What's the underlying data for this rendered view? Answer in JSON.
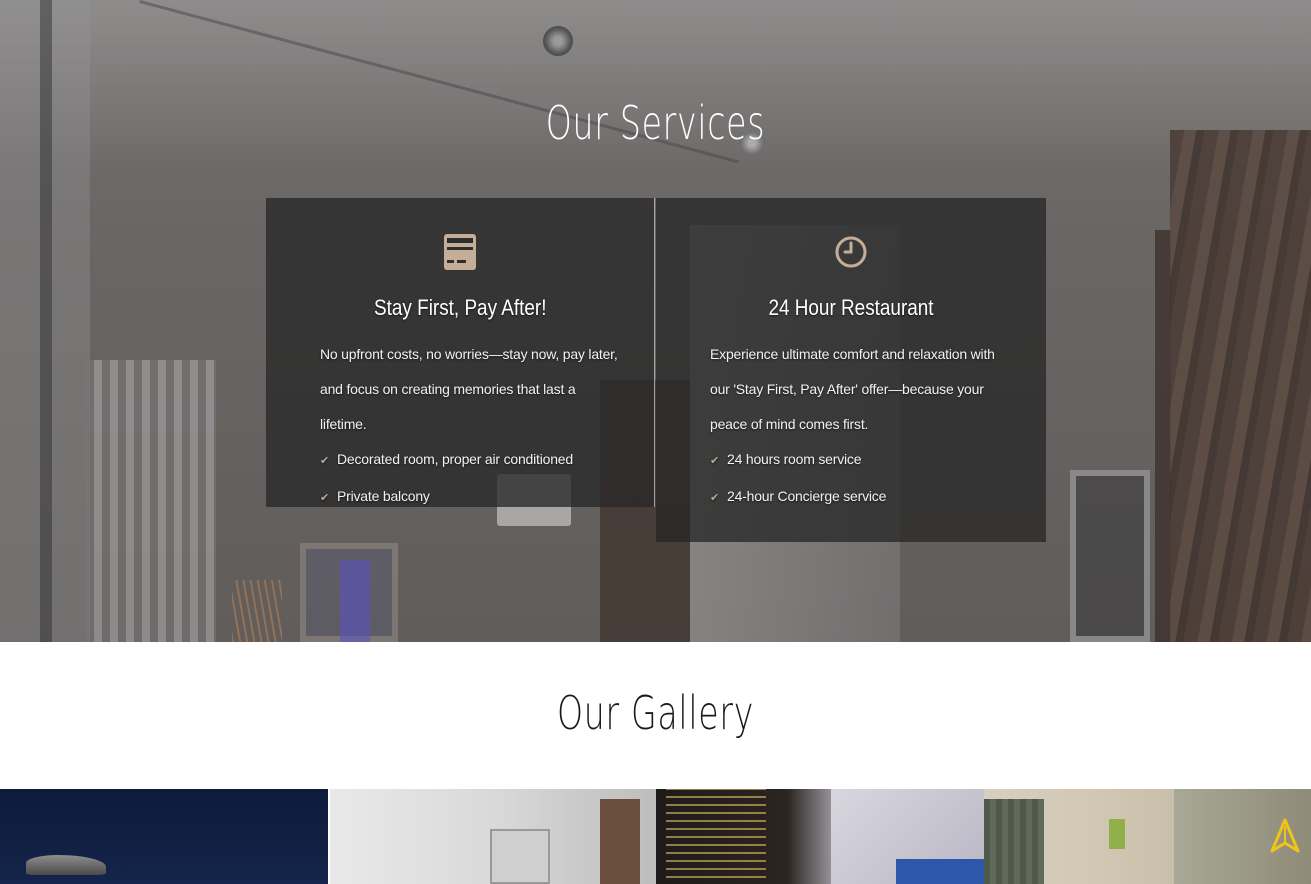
{
  "services": {
    "title": "Our Services",
    "cards": [
      {
        "icon": "credit-card-icon",
        "title": "Stay First, Pay After!",
        "description": "No upfront costs, no worries—stay now, pay later, and focus on creating memories that last a lifetime.",
        "features": [
          "Decorated room, proper air conditioned",
          "Private balcony"
        ]
      },
      {
        "icon": "clock-icon",
        "title": "24 Hour Restaurant",
        "description": "Experience ultimate comfort and relaxation with our 'Stay First, Pay After' offer—because your peace of mind comes first.",
        "features": [
          "24 hours room service",
          "24-hour Concierge service"
        ]
      }
    ]
  },
  "gallery": {
    "title": "Our Gallery",
    "items": [
      "gallery-image-night-marina",
      "gallery-image-bright-room",
      "gallery-image-city-view",
      "gallery-image-hotel-room"
    ]
  },
  "colors": {
    "accent": "#c4ae98",
    "card_bg": "#282828",
    "check": "#b8a898",
    "nav_arrow": "#f0c419"
  }
}
